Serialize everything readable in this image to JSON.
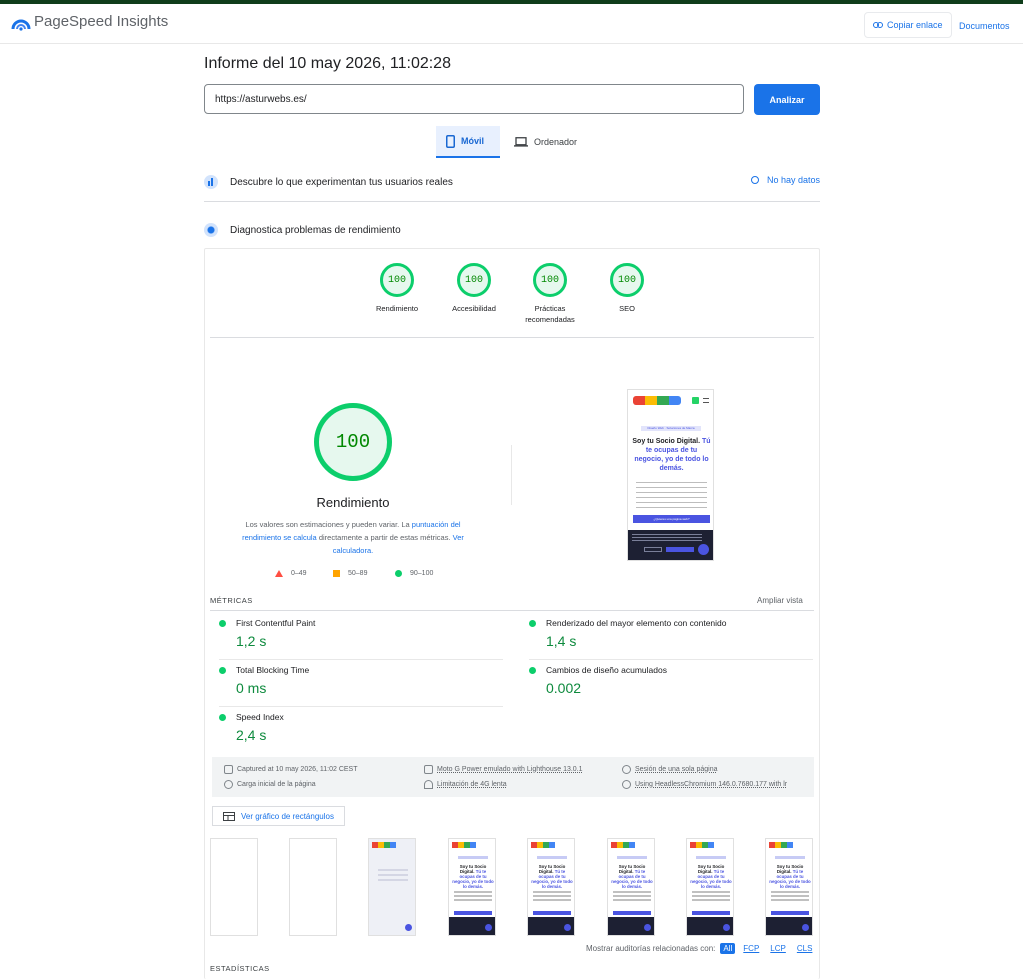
{
  "app": {
    "title": "PageSpeed Insights",
    "copy_link": "Copiar enlace",
    "docs": "Documentos"
  },
  "report": {
    "title": "Informe del 10 may 2026, 11:02:28"
  },
  "search": {
    "url": "https://asturwebs.es/",
    "analyze": "Analizar"
  },
  "tabs": [
    {
      "label": "Móvil",
      "active": true
    },
    {
      "label": "Ordenador",
      "active": false
    }
  ],
  "field_data": {
    "title": "Descubre lo que experimentan tus usuarios reales",
    "status": "No hay datos"
  },
  "diagnose": {
    "title": "Diagnostica problemas de rendimiento"
  },
  "categories": [
    {
      "score": "100",
      "label": "Rendimiento"
    },
    {
      "score": "100",
      "label": "Accesibilidad"
    },
    {
      "score": "100",
      "label": "Prácticas recomendadas"
    },
    {
      "score": "100",
      "label": "SEO"
    }
  ],
  "performance": {
    "score": "100",
    "label": "Rendimiento",
    "disclaimer_pre": "Los valores son estimaciones y pueden variar. La ",
    "disclaimer_link1": "puntuación del rendimiento se calcula",
    "disclaimer_mid": " directamente a partir de estas métricas. ",
    "disclaimer_link2": "Ver calculadora."
  },
  "legend": {
    "fail": "0–49",
    "average": "50–89",
    "pass": "90–100"
  },
  "colors": {
    "pass": "#0cce6b",
    "average": "#ffa400",
    "fail": "#ff4e42",
    "accent": "#1a73e8"
  },
  "screenshot": {
    "chip": "Diseño Web · Soluciones de Marca",
    "h_black": "Soy tu Socio Digital.",
    "h_blue": "Tú te ocupas de tu negocio, yo de todo lo demás.",
    "button": "¿Quieres una página web?"
  },
  "metrics_section": {
    "title": "MÉTRICAS",
    "expand": "Ampliar vista"
  },
  "metrics": [
    {
      "name": "First Contentful Paint",
      "value": "1,2 s"
    },
    {
      "name": "Renderizado del mayor elemento con contenido",
      "value": "1,4 s"
    },
    {
      "name": "Total Blocking Time",
      "value": "0 ms"
    },
    {
      "name": "Cambios de diseño acumulados",
      "value": "0.002"
    },
    {
      "name": "Speed Index",
      "value": "2,4 s"
    }
  ],
  "runtime": {
    "captured": "Captured at 10 may 2026, 11:02 CEST",
    "device": "Moto G Power emulado with Lighthouse 13.0.1",
    "session": "Sesión de una sola página",
    "load": "Carga inicial de la página",
    "throttle": "Limitación de 4G lenta",
    "browser": "Using HeadlessChromium 146.0.7680.177 with lr"
  },
  "treemap": {
    "label": "Ver gráfico de rectángulos"
  },
  "filters": {
    "label": "Mostrar auditorías relacionadas con:",
    "items": [
      "All",
      "FCP",
      "LCP",
      "CLS"
    ]
  },
  "stats": {
    "title": "ESTADÍSTICAS"
  }
}
